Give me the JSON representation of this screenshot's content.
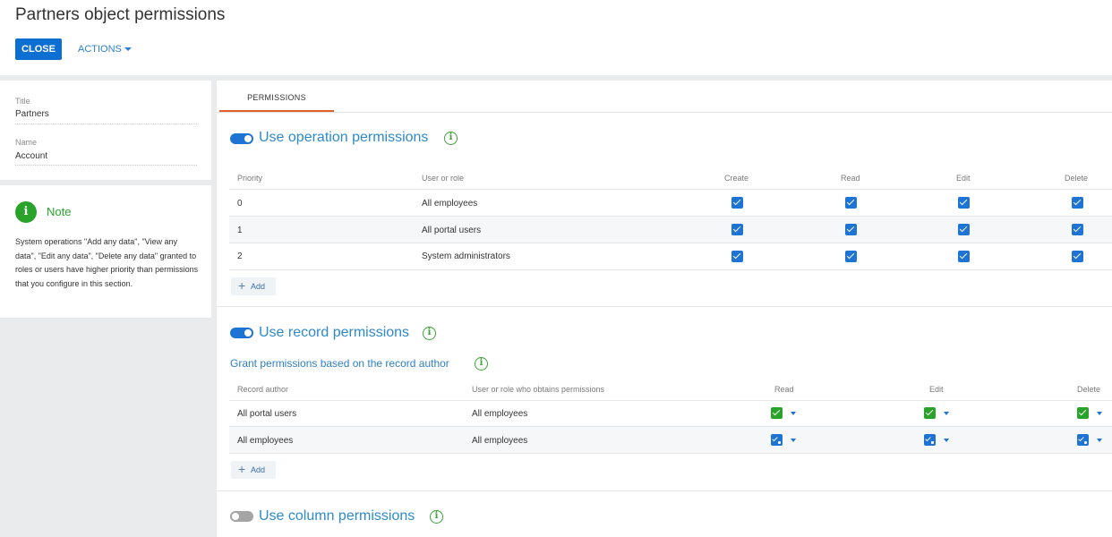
{
  "header": {
    "title": "Partners object permissions",
    "close_label": "CLOSE",
    "actions_label": "ACTIONS"
  },
  "details": {
    "title_label": "Title",
    "title_value": "Partners",
    "name_label": "Name",
    "name_value": "Account"
  },
  "note": {
    "icon": "i",
    "title": "Note",
    "text": "System operations \"Add any data\", \"View any data\", \"Edit any data\", \"Delete any data\" granted to roles or users have higher priority than permissions that you configure in this section."
  },
  "tabs": [
    {
      "label": "PERMISSIONS",
      "active": true
    }
  ],
  "operation_permissions": {
    "title": "Use operation permissions",
    "enabled": true,
    "info_icon": "i",
    "columns": [
      "Priority",
      "User or role",
      "Create",
      "Read",
      "Edit",
      "Delete"
    ],
    "rows": [
      {
        "priority": "0",
        "role": "All employees",
        "create": true,
        "read": true,
        "edit": true,
        "delete": true
      },
      {
        "priority": "1",
        "role": "All portal users",
        "create": true,
        "read": true,
        "edit": true,
        "delete": true
      },
      {
        "priority": "2",
        "role": "System administrators",
        "create": true,
        "read": true,
        "edit": true,
        "delete": true
      }
    ],
    "add_label": "Add"
  },
  "record_permissions": {
    "title": "Use record permissions",
    "enabled": true,
    "info_icon": "i",
    "subtitle": "Grant permissions based on the record author",
    "columns": [
      "Record author",
      "User or role who obtains permissions",
      "Read",
      "Edit",
      "Delete"
    ],
    "rows": [
      {
        "author": "All portal users",
        "grantee": "All employees",
        "read": "granted",
        "edit": "granted",
        "delete": "granted"
      },
      {
        "author": "All employees",
        "grantee": "All employees",
        "read": "granted-with-delegation",
        "edit": "granted-with-delegation",
        "delete": "granted-with-delegation"
      }
    ],
    "add_label": "Add"
  },
  "column_permissions": {
    "title": "Use column permissions",
    "enabled": false,
    "info_icon": "i"
  },
  "colors": {
    "primary": "#0d6fd1",
    "link": "#2e8ac9",
    "success": "#29a329",
    "tab_accent": "#e35f2a"
  }
}
